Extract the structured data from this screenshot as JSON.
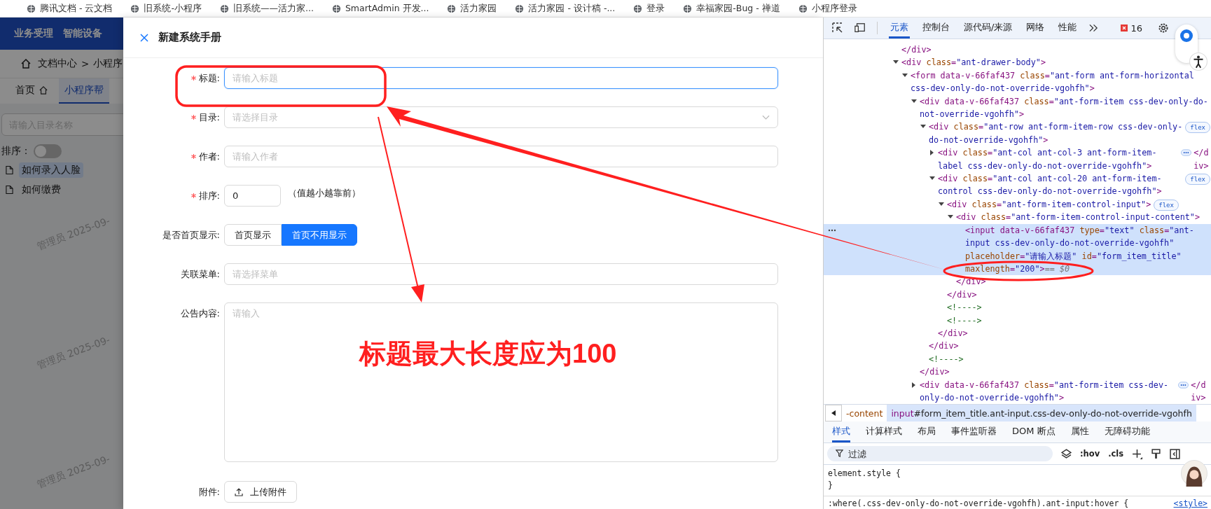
{
  "bookmarks": [
    {
      "label": "腾讯文档 - 云文档"
    },
    {
      "label": "旧系统-小程序"
    },
    {
      "label": "旧系统——活力家..."
    },
    {
      "label": "SmartAdmin 开发..."
    },
    {
      "label": "活力家园"
    },
    {
      "label": "活力家园 - 设计稿 -..."
    },
    {
      "label": "登录"
    },
    {
      "label": "幸福家园-Bug - 禅道"
    },
    {
      "label": "小程序登录"
    }
  ],
  "app": {
    "nav": [
      "业务受理",
      "智能设备"
    ],
    "breadcrumb": [
      "文档中心",
      "小程序"
    ],
    "separator": ">",
    "tabs": [
      {
        "label": "首页",
        "selected": false
      },
      {
        "label": "小程序帮",
        "selected": true
      }
    ],
    "search_placeholder": "请输入目录名称",
    "sort_label": "排序：",
    "sort_on": false,
    "tree": [
      {
        "label": "如何录入人脸",
        "selected": true
      },
      {
        "label": "如何缴费",
        "selected": false
      }
    ],
    "watermarks": [
      "管理员 2025-09-",
      "管理员 2025-09-",
      "管理员 2025-09-"
    ]
  },
  "drawer": {
    "title": "新建系统手册",
    "fields": [
      {
        "label": "标题:",
        "required": true,
        "kind": "input",
        "placeholder": "请输入标题",
        "focused": true
      },
      {
        "label": "目录:",
        "required": true,
        "kind": "select",
        "placeholder": "请选择目录",
        "focused": false
      },
      {
        "label": "作者:",
        "required": true,
        "kind": "input",
        "placeholder": "请输入作者",
        "focused": false
      },
      {
        "label": "排序:",
        "required": true,
        "kind": "number",
        "value": "0",
        "hint": "（值越小越靠前）",
        "focused": false
      },
      {
        "label": "是否首页显示:",
        "required": false,
        "kind": "radio",
        "options": [
          {
            "label": "首页显示",
            "selected": false
          },
          {
            "label": "首页不用显示",
            "selected": true
          }
        ]
      },
      {
        "label": "关联菜单:",
        "required": false,
        "kind": "input",
        "placeholder": "请选择菜单",
        "focused": false
      },
      {
        "label": "公告内容:",
        "required": false,
        "kind": "textarea",
        "placeholder": "请输入",
        "focused": false
      },
      {
        "label": "附件:",
        "required": false,
        "kind": "upload",
        "button": "上传附件"
      }
    ]
  },
  "annotation": {
    "callout": "标题最大长度应为100"
  },
  "devtools": {
    "tabs": [
      {
        "label": "元素",
        "selected": true
      },
      {
        "label": "控制台",
        "selected": false
      },
      {
        "label": "源代码/来源",
        "selected": false
      },
      {
        "label": "网络",
        "selected": false
      },
      {
        "label": "性能",
        "selected": false
      }
    ],
    "error_count": "16",
    "dom": [
      {
        "open": "</div>"
      },
      {
        "open": "<div class=\"ant-drawer-body\">",
        "expanded": true,
        "children": [
          {
            "open": "<form data-v-66faf437 class=\"ant-form ant-form-horizontal css-dev-only-do-not-override-vgohfh\">",
            "expanded": true,
            "children": [
              {
                "open": "<div data-v-66faf437 class=\"ant-form-item css-dev-only-do-not-override-vgohfh\">",
                "expanded": true,
                "children": [
                  {
                    "open": "<div class=\"ant-row ant-form-item-row css-dev-only-do-not-override-vgohfh\">",
                    "badge": "flex",
                    "expanded": true,
                    "children": [
                      {
                        "open": "<div class=\"ant-col ant-col-3 ant-form-item-label css-dev-only-do-not-override-vgohfh\">",
                        "expanded": false,
                        "close": "</div>"
                      },
                      {
                        "open": "<div class=\"ant-col ant-col-20 ant-form-item-control css-dev-only-do-not-override-vgohfh\">",
                        "badge": "flex",
                        "expanded": true,
                        "children": [
                          {
                            "open": "<div class=\"ant-form-item-control-input\">",
                            "badge": "flex",
                            "expanded": true,
                            "children": [
                              {
                                "open": "<div class=\"ant-form-item-control-input-content\">",
                                "expanded": true,
                                "children": [
                                  {
                                    "open": "<input data-v-66faf437 type=\"text\" class=\"ant-input css-dev-only-do-not-override-vgohfh\" placeholder=\"请输入标题\" id=\"form_item_title\" maxlength=\"200\">",
                                    "selected": true,
                                    "suffix": "== $0"
                                  }
                                ],
                                "close": "</div>"
                              }
                            ],
                            "close": "</div>"
                          },
                          {
                            "open": "<!---->"
                          },
                          {
                            "open": "<!---->"
                          }
                        ],
                        "close": "</div>"
                      }
                    ],
                    "close": "</div>"
                  },
                  {
                    "open": "<!---->"
                  }
                ],
                "close": "</div>"
              },
              {
                "open": "<div data-v-66faf437 class=\"ant-form-item css-dev-only-do-not-override-vgohfh\">",
                "expanded": false,
                "close": "</div>"
              }
            ]
          }
        ]
      }
    ],
    "crumbs": [
      {
        "text": "-content",
        "selected": false
      },
      {
        "text": "input#form_item_title.ant-input.css-dev-only-do-not-override-vgohfh",
        "selected": true
      }
    ],
    "subtabs": [
      {
        "label": "样式",
        "selected": true
      },
      {
        "label": "计算样式",
        "selected": false
      },
      {
        "label": "布局",
        "selected": false
      },
      {
        "label": "事件监听器",
        "selected": false
      },
      {
        "label": "DOM 断点",
        "selected": false
      },
      {
        "label": "属性",
        "selected": false
      },
      {
        "label": "无障碍功能",
        "selected": false
      }
    ],
    "filter_placeholder": "过滤",
    "hov": ":hov",
    "cls": ".cls",
    "style_lines": [
      "element.style {",
      "}",
      ":where(.css-dev-only-do-not-override-vgohfh).ant-input:hover {"
    ],
    "style_source": "<style>"
  }
}
